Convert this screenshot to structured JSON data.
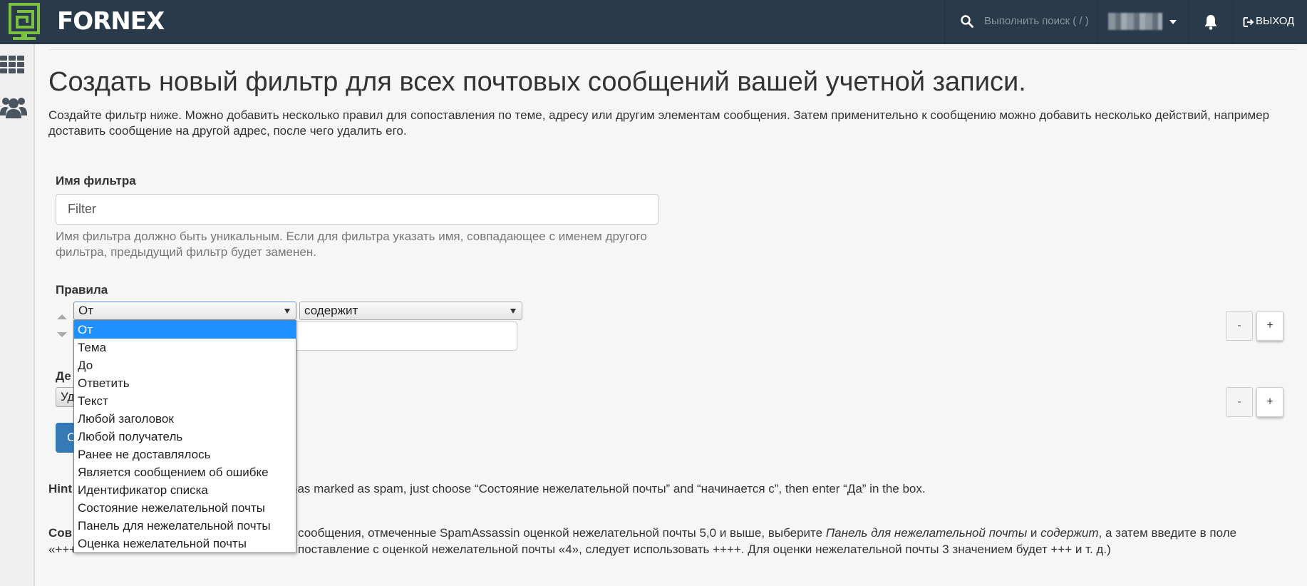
{
  "header": {
    "brand": "FORNEX",
    "search_placeholder": "Выполнить поиск ( / )",
    "logout_label": "ВЫХОД"
  },
  "page": {
    "title": "Создать новый фильтр для всех почтовых сообщений вашей учетной записи.",
    "description": "Создайте фильтр ниже. Можно добавить несколько правил для сопоставления по теме, адресу или другим элементам сообщения. Затем применительно к сообщению можно добавить несколько действий, например доставить сообщение на другой адрес, после чего удалить его."
  },
  "form": {
    "filter_name_label": "Имя фильтра",
    "filter_name_value": "Filter",
    "filter_name_help": "Имя фильтра должно быть уникальным. Если для фильтра указать имя, совпадающее с именем другого фильтра, предыдущий фильтр будет заменен.",
    "rules_label": "Правила",
    "rule_field_selected": "От",
    "rule_operator_selected": "содержит",
    "actions_label_visible": "Де",
    "action_select_visible": "Уд",
    "create_button_visible": "С",
    "minus_label": "-",
    "plus_label": "+"
  },
  "dropdown": {
    "options": [
      "От",
      "Тема",
      "До",
      "Ответить",
      "Текст",
      "Любой заголовок",
      "Любой получатель",
      "Ранее не доставлялось",
      "Является сообщением об ошибке",
      "Идентификатор списка",
      "Состояние нежелательной почты",
      "Панель для нежелательной почты",
      "Оценка нежелательной почты"
    ],
    "selected_index": 0
  },
  "hint": {
    "lead_visible": "Hint",
    "text_visible": "has marked as spam, just choose “Состояние нежелательной почты” and “начинается с”, then enter “Да” in the box."
  },
  "advice": {
    "lead_visible": "Сов",
    "line1_a": "сообщения, отмеченные SpamAssassin оценкой нежелательной почты 5,0 и выше, выберите ",
    "line1_em1": "Панель для нежелательной почты",
    "line1_b": " и ",
    "line1_em2": "содержит",
    "line1_c": ", а затем введите в поле",
    "line2_lead_visible": "«+++",
    "line2_text": "поставление с оценкой нежелательной почты «4», следует использовать ++++. Для оценки нежелательной почты 3 значением будет +++ и т. д.)"
  },
  "colors": {
    "navbar": "#293a4a",
    "logo_green": "#7cc242",
    "primary_button": "#337ab7",
    "dropdown_selected": "#1e90ff"
  }
}
